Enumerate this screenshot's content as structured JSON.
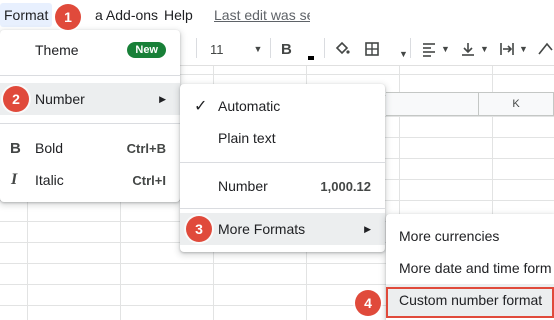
{
  "menubar": {
    "format_label": "Format",
    "addons_label": "a Add-ons",
    "help_label": "Help",
    "last_edit_label": "Last edit was se"
  },
  "toolbar": {
    "font_size": "11",
    "bold_label": "B",
    "icons": [
      "text-color-icon",
      "fill-color-icon",
      "borders-icon",
      "horizontal-align-icon",
      "vertical-align-icon",
      "text-wrap-icon",
      "text-rotation-icon"
    ]
  },
  "grid": {
    "column_label": "K"
  },
  "format_menu": {
    "items": [
      {
        "label": "Theme",
        "badge": "New"
      },
      {
        "label": "Number"
      },
      {
        "label": "Bold",
        "shortcut": "Ctrl+B",
        "icon": "B"
      },
      {
        "label": "Italic",
        "shortcut": "Ctrl+I",
        "icon": "I"
      }
    ]
  },
  "number_menu": {
    "items": [
      {
        "label": "Automatic",
        "checked": true
      },
      {
        "label": "Plain text"
      },
      {
        "label": "Number",
        "example": "1,000.12"
      },
      {
        "label": "More Formats"
      }
    ]
  },
  "more_formats_menu": {
    "items": [
      {
        "label": "More currencies"
      },
      {
        "label": "More date and time form"
      },
      {
        "label": "Custom number format"
      }
    ]
  },
  "steps": [
    "1",
    "2",
    "3",
    "4"
  ],
  "colors": {
    "accent_red": "#e04a3b",
    "badge_green": "#188038",
    "menu_active": "#eceeef",
    "format_tab": "#e8f0fe"
  }
}
